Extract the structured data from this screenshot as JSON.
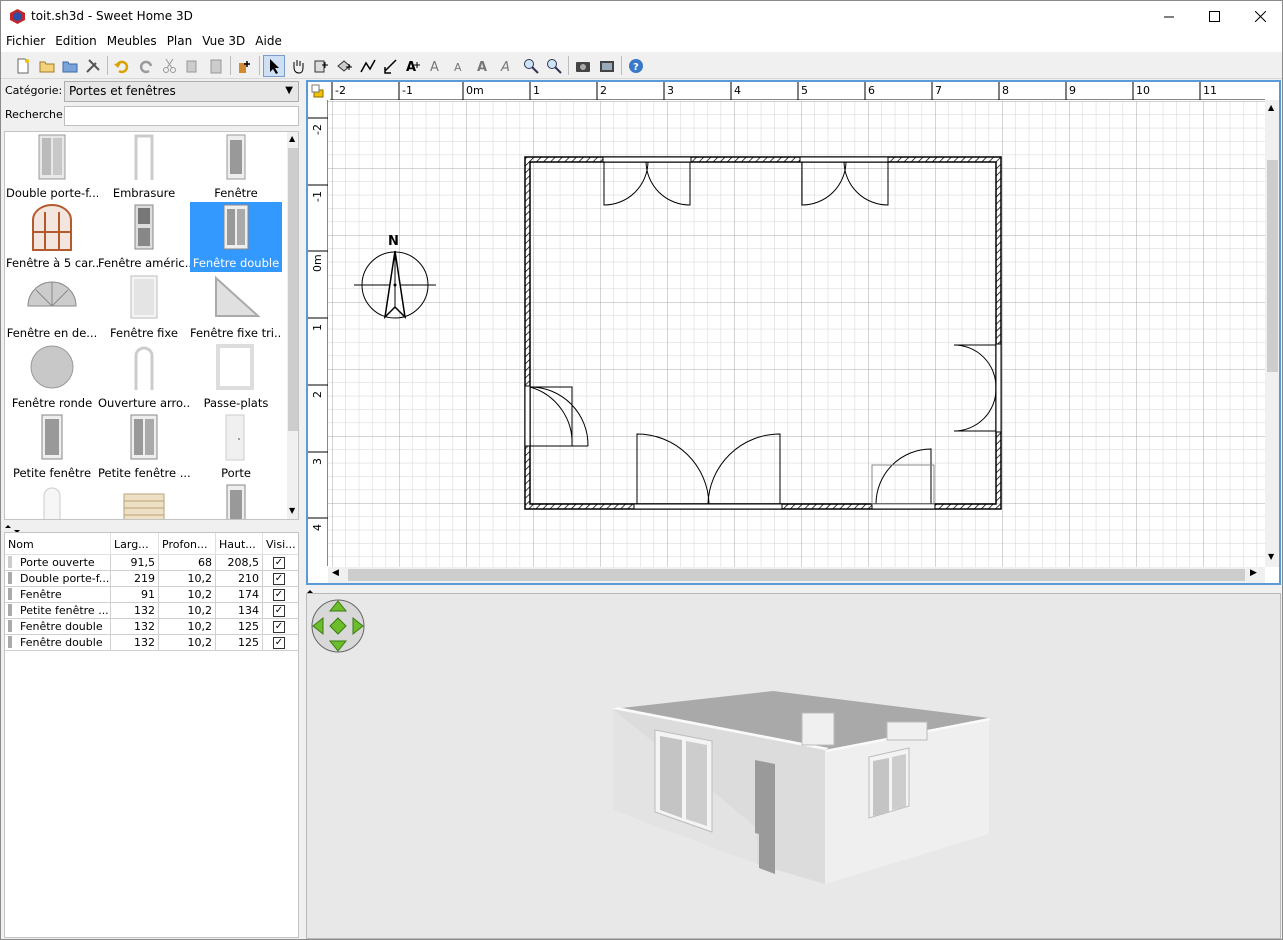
{
  "window": {
    "title": "toit.sh3d - Sweet Home 3D",
    "controls": [
      "minimize-icon",
      "maximize-icon",
      "close-icon"
    ]
  },
  "menu": [
    "Fichier",
    "Edition",
    "Meubles",
    "Plan",
    "Vue 3D",
    "Aide"
  ],
  "toolbar": [
    "new-home-icon",
    "open-icon",
    "save-icon",
    "preferences-icon",
    "undo-icon",
    "redo-icon",
    "cut-icon",
    "copy-icon",
    "paste-icon",
    "add-furniture-icon",
    "select-mode-icon",
    "pan-mode-icon",
    "create-walls-icon",
    "create-rooms-icon",
    "create-polylines-icon",
    "create-dimensions-icon",
    "create-labels-icon",
    "increase-text-icon",
    "decrease-text-icon",
    "bold-text-icon",
    "italic-text-icon",
    "zoom-in-icon",
    "zoom-out-icon",
    "create-photo-icon",
    "create-video-icon",
    "help-icon"
  ],
  "catalog": {
    "category_label": "Catégorie:",
    "category_value": "Portes et fenêtres",
    "search_label": "Recherche:",
    "search_value": "",
    "items": [
      {
        "label": "Double porte-f...",
        "icon": "double-french-door-icon"
      },
      {
        "label": "Embrasure",
        "icon": "door-frame-icon"
      },
      {
        "label": "Fenêtre",
        "icon": "window-icon"
      },
      {
        "label": "Fenêtre à 5 car...",
        "icon": "five-pane-window-icon"
      },
      {
        "label": "Fenêtre améric...",
        "icon": "american-window-icon"
      },
      {
        "label": "Fenêtre double",
        "icon": "double-window-icon",
        "selected": true
      },
      {
        "label": "Fenêtre en de...",
        "icon": "half-round-window-icon"
      },
      {
        "label": "Fenêtre fixe",
        "icon": "fixed-window-icon"
      },
      {
        "label": "Fenêtre fixe tri...",
        "icon": "triangular-window-icon"
      },
      {
        "label": "Fenêtre ronde",
        "icon": "round-window-icon"
      },
      {
        "label": "Ouverture arro...",
        "icon": "round-opening-icon"
      },
      {
        "label": "Passe-plats",
        "icon": "serving-hatch-icon"
      },
      {
        "label": "Petite fenêtre",
        "icon": "small-window-icon"
      },
      {
        "label": "Petite fenêtre ...",
        "icon": "small-double-window-icon"
      },
      {
        "label": "Porte",
        "icon": "door-icon"
      },
      {
        "label": "",
        "icon": "arched-door-icon"
      },
      {
        "label": "",
        "icon": "shutter-icon"
      },
      {
        "label": "",
        "icon": "glass-door-icon"
      }
    ]
  },
  "furniture_table": {
    "headers": [
      "Nom",
      "Larg...",
      "Profon...",
      "Haut...",
      "Visi..."
    ],
    "rows": [
      {
        "name": "Porte ouverte",
        "width": "91,5",
        "depth": "68",
        "height": "208,5",
        "visible": true
      },
      {
        "name": "Double porte-f...",
        "width": "219",
        "depth": "10,2",
        "height": "210",
        "visible": true
      },
      {
        "name": "Fenêtre",
        "width": "91",
        "depth": "10,2",
        "height": "174",
        "visible": true
      },
      {
        "name": "Petite fenêtre ...",
        "width": "132",
        "depth": "10,2",
        "height": "134",
        "visible": true
      },
      {
        "name": "Fenêtre double",
        "width": "132",
        "depth": "10,2",
        "height": "125",
        "visible": true
      },
      {
        "name": "Fenêtre double",
        "width": "132",
        "depth": "10,2",
        "height": "125",
        "visible": true
      }
    ]
  },
  "plan": {
    "hruler": [
      "-2",
      "-1",
      "0m",
      "1",
      "2",
      "3",
      "4",
      "5",
      "6",
      "7",
      "8",
      "9",
      "10",
      "11"
    ],
    "vruler": [
      "-2",
      "-1",
      "0m",
      "1",
      "2",
      "3",
      "4"
    ],
    "compass_label": "N"
  },
  "view3d": {
    "navigation": "navigation-arrows-icon"
  },
  "colors": {
    "selection": "#3399ff",
    "plan_border": "#5a9ad8",
    "view3d_background": "#e8e8e8"
  }
}
